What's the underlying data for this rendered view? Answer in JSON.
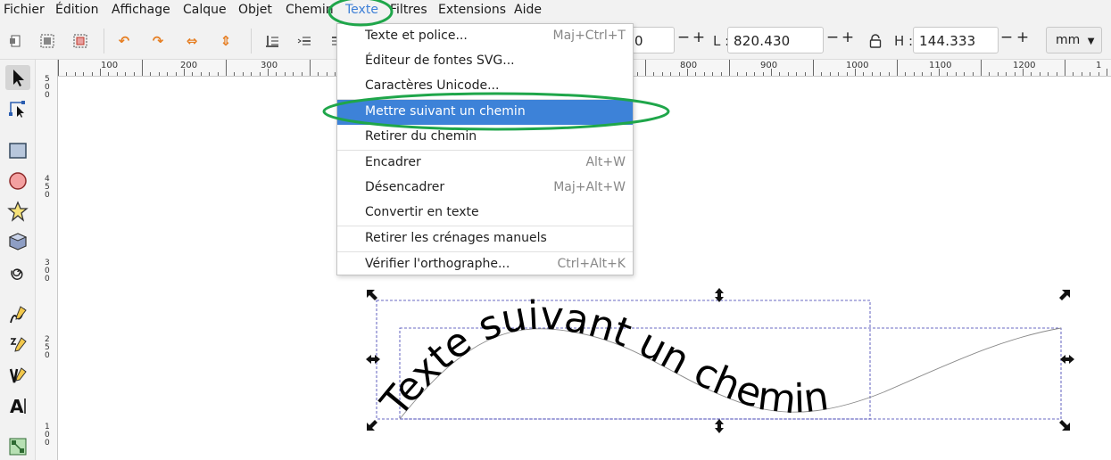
{
  "menubar": {
    "items": [
      "Fichier",
      "Édition",
      "Affichage",
      "Calque",
      "Objet",
      "Chemin",
      "Texte",
      "Filtres",
      "Extensions",
      "Aide"
    ]
  },
  "toolbar": {
    "x_value_partial": "0",
    "w_label": "L :",
    "w_value": "820.430",
    "h_label": "H :",
    "h_value": "144.333",
    "unit": "mm",
    "minus": "−",
    "plus": "+"
  },
  "ruler": {
    "h_labels": [
      "100",
      "200",
      "300",
      "800",
      "900",
      "1000",
      "1100",
      "1200",
      "1"
    ],
    "v_labels": [
      "5",
      "0",
      "0",
      "4",
      "5",
      "0",
      "3",
      "0",
      "0",
      "2",
      "5",
      "0",
      "1",
      "0",
      "0"
    ]
  },
  "text_menu": {
    "items": [
      {
        "label": "Texte et police...",
        "shortcut": "Maj+Ctrl+T"
      },
      {
        "label": "Éditeur de fontes SVG...",
        "shortcut": ""
      },
      {
        "label": "Caractères Unicode...",
        "shortcut": ""
      },
      {
        "label": "Mettre suivant un chemin",
        "shortcut": ""
      },
      {
        "label": "Retirer du chemin",
        "shortcut": ""
      },
      {
        "label": "Encadrer",
        "shortcut": "Alt+W"
      },
      {
        "label": "Désencadrer",
        "shortcut": "Maj+Alt+W"
      },
      {
        "label": "Convertir en texte",
        "shortcut": ""
      },
      {
        "label": "Retirer les crénages manuels",
        "shortcut": ""
      },
      {
        "label": "Vérifier l'orthographe...",
        "shortcut": "Ctrl+Alt+K"
      }
    ],
    "highlighted_index": 3
  },
  "canvas": {
    "path_text": "Texte suivant un chemin"
  },
  "colors": {
    "highlight": "#3d82d8",
    "annotation": "#1fa64a",
    "active_menu": "#3d7fd6",
    "selection": "#3a3ab0"
  }
}
